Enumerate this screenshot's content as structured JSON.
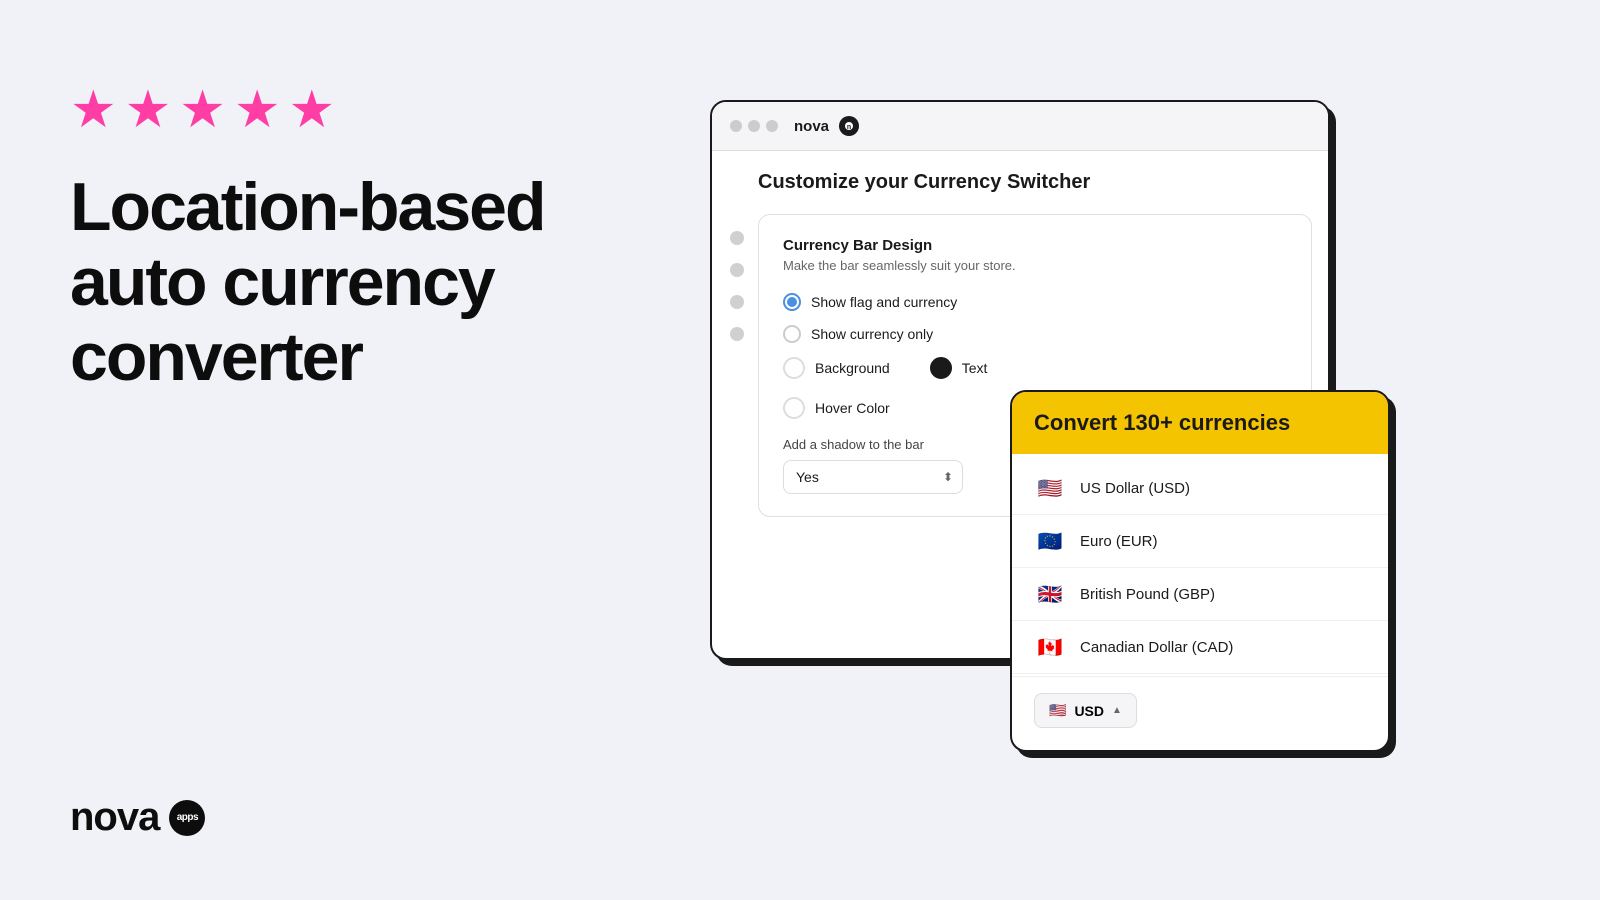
{
  "background_color": "#f0f2f7",
  "left": {
    "stars_count": 5,
    "star_color": "#ff3ea5",
    "headline_line1": "Location-based",
    "headline_line2": "auto currency",
    "headline_line3": "converter",
    "logo_text": "nova",
    "logo_badge": "apps"
  },
  "browser_window": {
    "title": "nova",
    "page_title": "Customize your Currency Switcher",
    "card": {
      "title": "Currency Bar Design",
      "subtitle": "Make the bar seamlessly suit your store.",
      "radio_options": [
        {
          "label": "Show flag and currency",
          "selected": true
        },
        {
          "label": "Show currency only",
          "selected": false
        }
      ],
      "color_options": [
        {
          "label": "Background",
          "dark": false
        },
        {
          "label": "Text",
          "dark": true
        }
      ],
      "hover_label": "Hover Color",
      "shadow_label": "Add a shadow to the bar",
      "shadow_value": "Yes"
    }
  },
  "currency_dropdown": {
    "header": "Convert 130+ currencies",
    "currencies": [
      {
        "name": "US Dollar (USD)",
        "flag": "🇺🇸"
      },
      {
        "name": "Euro (EUR)",
        "flag": "🇪🇺"
      },
      {
        "name": "British Pound (GBP)",
        "flag": "🇬🇧"
      },
      {
        "name": "Canadian Dollar (CAD)",
        "flag": "🇨🇦"
      }
    ],
    "selector": {
      "flag": "🇺🇸",
      "currency": "USD"
    }
  }
}
